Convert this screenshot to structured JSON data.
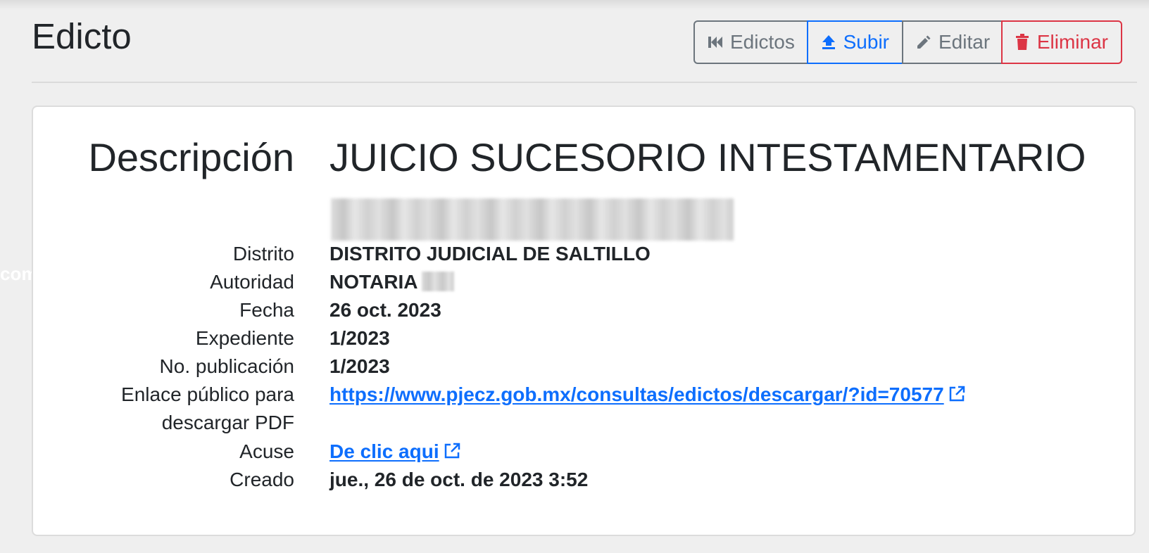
{
  "page": {
    "title": "Edicto",
    "side_fragment": "com"
  },
  "toolbar": {
    "edictos_label": "Edictos",
    "subir_label": "Subir",
    "editar_label": "Editar",
    "eliminar_label": "Eliminar"
  },
  "details": {
    "descripcion": {
      "label": "Descripción",
      "value": "JUICIO SUCESORIO INTESTAMENTARIO"
    },
    "distrito": {
      "label": "Distrito",
      "value": "DISTRITO JUDICIAL DE SALTILLO"
    },
    "autoridad": {
      "label": "Autoridad",
      "value": "NOTARIA"
    },
    "fecha": {
      "label": "Fecha",
      "value": "26 oct. 2023"
    },
    "expediente": {
      "label": "Expediente",
      "value": "1/2023"
    },
    "publicacion": {
      "label": "No. publicación",
      "value": "1/2023"
    },
    "enlace": {
      "label_line1": "Enlace público para",
      "label_line2": "descargar PDF",
      "value": "https://www.pjecz.gob.mx/consultas/edictos/descargar/?id=70577"
    },
    "acuse": {
      "label": "Acuse",
      "value": "De clic aqui"
    },
    "creado": {
      "label": "Creado",
      "value": "jue., 26 de oct. de 2023 3:52"
    }
  },
  "colors": {
    "primary": "#0d6efd",
    "secondary": "#6c757d",
    "danger": "#dc3545",
    "background": "#efefef",
    "card": "#ffffff"
  },
  "icons": {
    "edictos": "skip-previous-icon",
    "subir": "upload-icon",
    "editar": "pencil-icon",
    "eliminar": "trash-icon",
    "external": "external-link-icon"
  }
}
